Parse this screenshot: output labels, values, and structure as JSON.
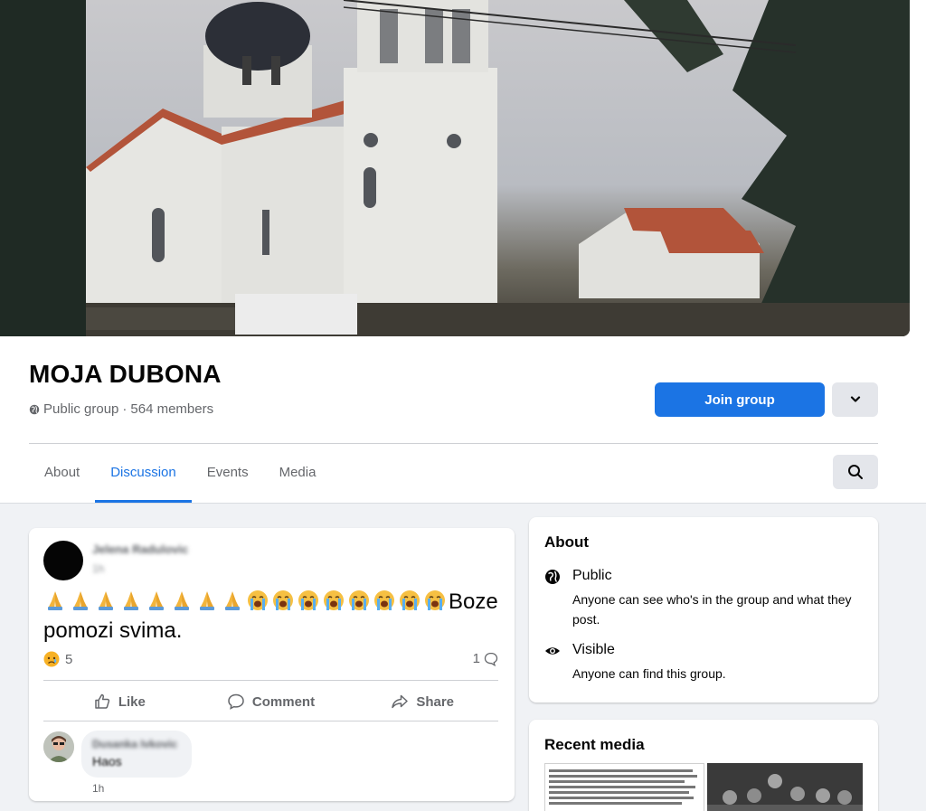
{
  "group": {
    "name": "MOJA DUBONA",
    "privacy": "Public group",
    "separator": "·",
    "members": "564 members",
    "join_label": "Join group"
  },
  "tabs": [
    {
      "label": "About",
      "active": false
    },
    {
      "label": "Discussion",
      "active": true
    },
    {
      "label": "Events",
      "active": false
    },
    {
      "label": "Media",
      "active": false
    }
  ],
  "post": {
    "author": "Jelena Radulovic",
    "time": "1h",
    "emoji_prayer_count": 8,
    "emoji_crying_count": 8,
    "text": "Boze pomozi svima.",
    "reaction_icon": "sad-face-icon",
    "reaction_count": "5",
    "comment_count": "1",
    "actions": {
      "like": "Like",
      "comment": "Comment",
      "share": "Share"
    },
    "comment": {
      "author": "Dusanka Ivkovic",
      "text": "Haos",
      "time": "1h"
    }
  },
  "about": {
    "title": "About",
    "items": [
      {
        "icon": "globe-icon",
        "label": "Public",
        "description": "Anyone can see who's in the group and what they post."
      },
      {
        "icon": "eye-icon",
        "label": "Visible",
        "description": "Anyone can find this group."
      }
    ]
  },
  "recent_media": {
    "title": "Recent media"
  },
  "colors": {
    "accent": "#1b74e4",
    "background": "#f0f2f5",
    "secondary_text": "#65676b"
  }
}
